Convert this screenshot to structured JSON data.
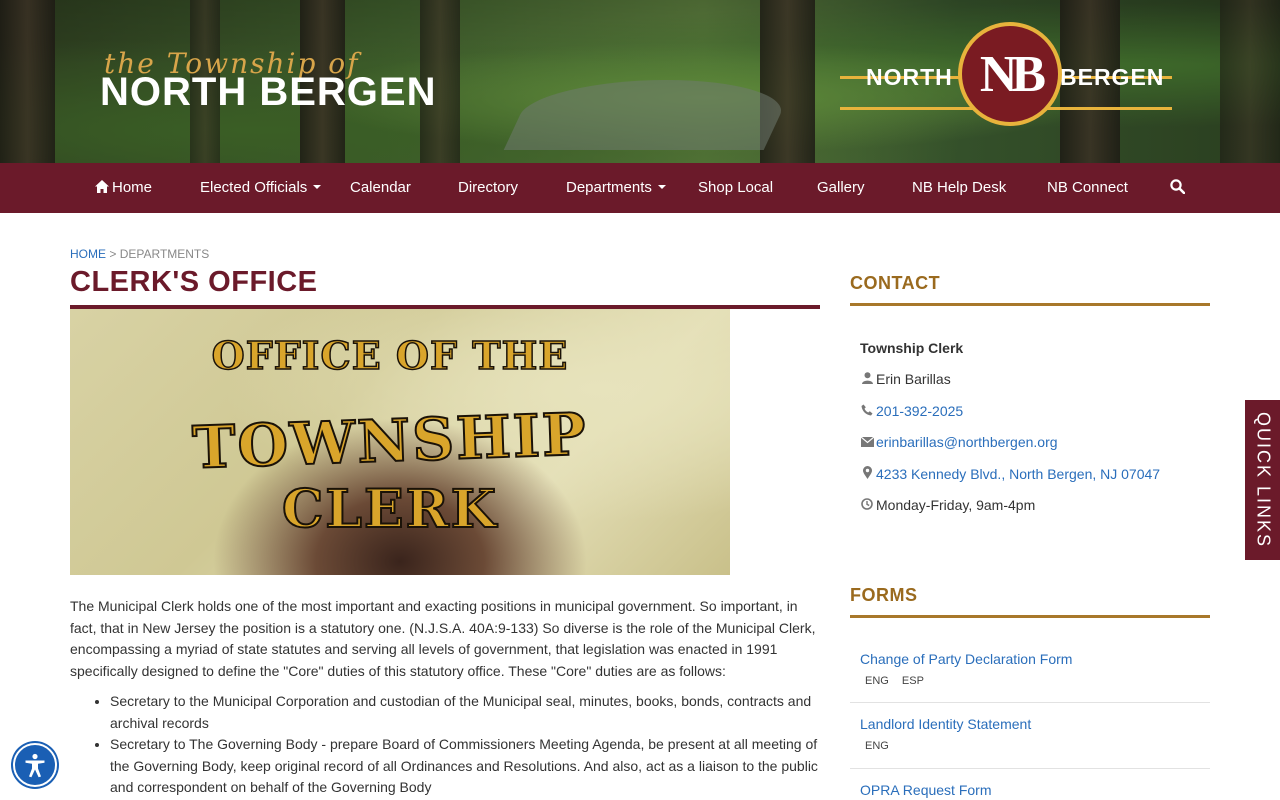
{
  "header": {
    "logo_script": "the Township of",
    "logo_main": "NORTH BERGEN",
    "badge_left": "NORTH",
    "badge_mono": "NB",
    "badge_right": "BERGEN"
  },
  "nav": {
    "items": [
      {
        "label": "Home",
        "icon": "home-icon"
      },
      {
        "label": "Elected Officials",
        "dropdown": true
      },
      {
        "label": "Calendar"
      },
      {
        "label": "Directory"
      },
      {
        "label": "Departments",
        "dropdown": true
      },
      {
        "label": "Shop Local"
      },
      {
        "label": "Gallery"
      },
      {
        "label": "NB Help Desk"
      },
      {
        "label": "NB Connect"
      }
    ],
    "search_icon": "search-icon"
  },
  "breadcrumb": {
    "home": "HOME",
    "sep": ">",
    "current": "DEPARTMENTS"
  },
  "page_title": "CLERK'S OFFICE",
  "hero": {
    "line1": "OFFICE OF THE",
    "line2": "TOWNSHIP",
    "line3": "CLERK"
  },
  "content": {
    "intro": " The Municipal Clerk holds one of the most important and exacting positions in municipal government. So important, in fact, that in New Jersey the position is a statutory one. (N.J.S.A. 40A:9-133) So diverse is the role of the Municipal Clerk, encompassing a myriad of state statutes and serving all levels of government, that legislation was enacted in 1991 specifically designed to define the \"Core\" duties of this statutory office. These \"Core\" duties are as follows:",
    "duties": [
      "Secretary to the Municipal Corporation and custodian of the Municipal seal, minutes, books, bonds, contracts and archival records",
      "Secretary to The Governing Body - prepare Board of Commissioners Meeting Agenda, be present at all meeting of the Governing Body, keep original record of all Ordinances and Resolutions. And also, act as a liaison to the public and correspondent on behalf of the Governing Body"
    ]
  },
  "contact": {
    "heading": "CONTACT",
    "title": "Township Clerk",
    "name": "Erin Barillas",
    "phone": "201-392-2025",
    "email": "erinbarillas@northbergen.org",
    "address": "4233 Kennedy Blvd., North Bergen, NJ 07047",
    "hours": "Monday-Friday, 9am-4pm"
  },
  "forms": {
    "heading": "FORMS",
    "items": [
      {
        "title": "Change of Party Declaration Form",
        "langs": [
          "ENG",
          "ESP"
        ]
      },
      {
        "title": "Landlord Identity Statement",
        "langs": [
          "ENG"
        ]
      },
      {
        "title": "OPRA Request Form",
        "langs": []
      }
    ]
  },
  "quick_links": "QUICK LINKS",
  "colors": {
    "maroon": "#6b1a2a",
    "gold": "#9a6a1e",
    "link": "#2a6ebb"
  }
}
